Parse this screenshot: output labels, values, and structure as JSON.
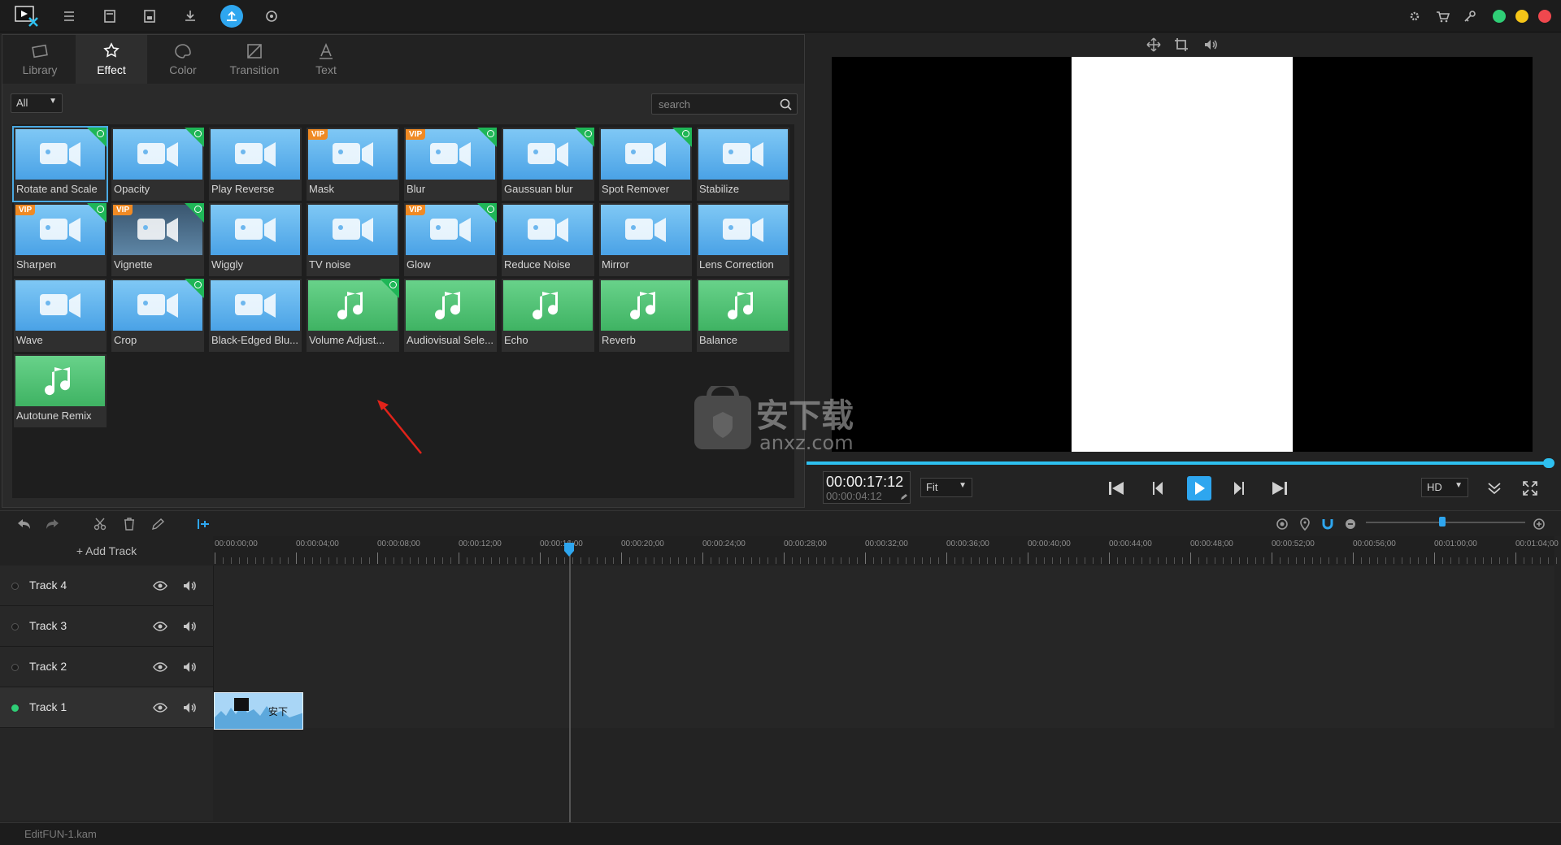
{
  "topbar": {
    "icons": [
      "menu-icon",
      "save-icon",
      "save-as-icon",
      "import-icon",
      "export-icon",
      "settings-icon"
    ],
    "right_icons": [
      "gear-icon",
      "cart-icon",
      "key-icon"
    ],
    "window_colors": {
      "restore": "#2fce76",
      "minimize": "#f5c518",
      "close": "#f0484e"
    }
  },
  "tabs": [
    {
      "label": "Library",
      "icon": "library-icon"
    },
    {
      "label": "Effect",
      "icon": "effect-icon",
      "active": true
    },
    {
      "label": "Color",
      "icon": "palette-icon"
    },
    {
      "label": "Transition",
      "icon": "transition-icon"
    },
    {
      "label": "Text",
      "icon": "text-icon"
    }
  ],
  "filter": {
    "value": "All"
  },
  "search": {
    "placeholder": "search"
  },
  "effects": [
    {
      "label": "Rotate and Scale",
      "color": "blue",
      "badge": "free",
      "selected": true
    },
    {
      "label": "Opacity",
      "color": "blue",
      "badge": "free"
    },
    {
      "label": "Play Reverse",
      "color": "blue"
    },
    {
      "label": "Mask",
      "color": "blue",
      "vip": "VIP"
    },
    {
      "label": "Blur",
      "color": "blue",
      "vip": "VIP",
      "badge": "free"
    },
    {
      "label": "Gaussuan blur",
      "color": "blue",
      "badge": "free"
    },
    {
      "label": "Spot Remover",
      "color": "blue",
      "badge": "free"
    },
    {
      "label": "Stabilize",
      "color": "blue"
    },
    {
      "label": "Sharpen",
      "color": "blue",
      "vip": "VIP",
      "badge": "free"
    },
    {
      "label": "Vignette",
      "color": "dark",
      "vip": "VIP",
      "badge": "free"
    },
    {
      "label": "Wiggly",
      "color": "blue"
    },
    {
      "label": "TV noise",
      "color": "blue"
    },
    {
      "label": "Glow",
      "color": "blue",
      "vip": "VIP",
      "badge": "free"
    },
    {
      "label": "Reduce Noise",
      "color": "blue"
    },
    {
      "label": "Mirror",
      "color": "blue"
    },
    {
      "label": "Lens Correction",
      "color": "blue"
    },
    {
      "label": "Wave",
      "color": "blue"
    },
    {
      "label": "Crop",
      "color": "blue",
      "badge": "free"
    },
    {
      "label": "Black-Edged Blu...",
      "color": "blue"
    },
    {
      "label": "Volume Adjust...",
      "color": "green",
      "badge": "free"
    },
    {
      "label": "Audiovisual Sele...",
      "color": "green"
    },
    {
      "label": "Echo",
      "color": "green"
    },
    {
      "label": "Reverb",
      "color": "green"
    },
    {
      "label": "Balance",
      "color": "green"
    },
    {
      "label": "Autotune Remix",
      "color": "green"
    }
  ],
  "preview": {
    "time_current": "00:00:17:12",
    "time_sub": "00:00:04:12",
    "fit": "Fit",
    "quality": "HD",
    "watermark_text": "安下载",
    "watermark_sub": "anxz.com"
  },
  "timeline": {
    "add_track": "+ Add Track",
    "ticks": [
      "00:00:00;00",
      "00:00:04;00",
      "00:00:08;00",
      "00:00:12;00",
      "00:00:16;00",
      "00:00:20;00",
      "00:00:24;00",
      "00:00:28;00",
      "00:00:32;00",
      "00:00:36;00",
      "00:00:40;00",
      "00:00:44;00",
      "00:00:48;00",
      "00:00:52;00",
      "00:00:56;00",
      "00:01:00;00",
      "00:01:04;00"
    ],
    "tracks": [
      {
        "name": "Track 4",
        "active": false
      },
      {
        "name": "Track 3",
        "active": false
      },
      {
        "name": "Track 2",
        "active": false
      },
      {
        "name": "Track 1",
        "active": true
      }
    ],
    "clip_text": "安下"
  },
  "status": {
    "filename": "EditFUN-1.kam"
  }
}
